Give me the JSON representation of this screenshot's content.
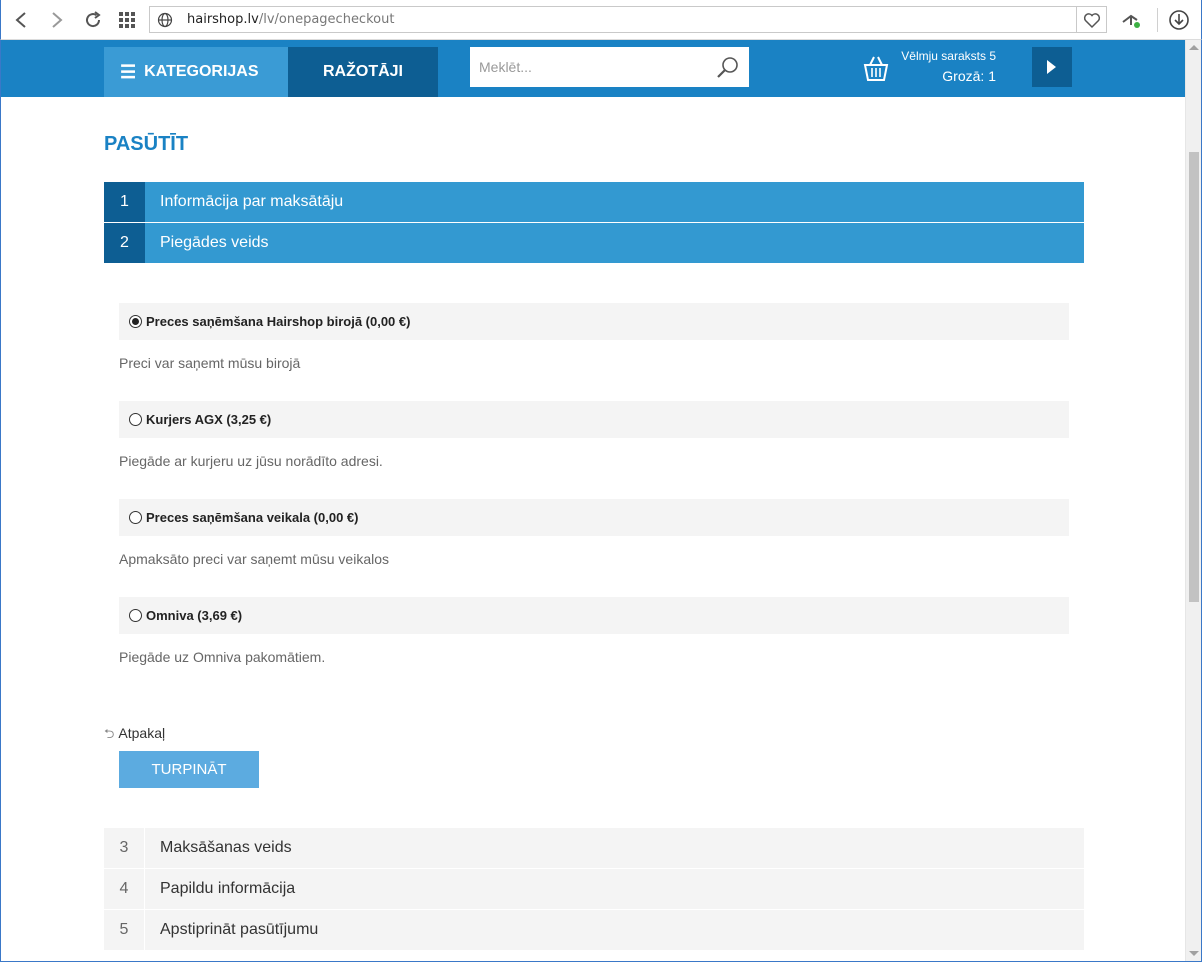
{
  "browser": {
    "url_host": "hairshop.lv",
    "url_path": "/lv/onepagecheckout"
  },
  "header": {
    "categories_label": "KATEGORIJAS",
    "brands_label": "RAŽOTĀJI",
    "search_placeholder": "Meklēt...",
    "wishlist_text": "Vēlmju saraksts 5",
    "cart_text": "Grozā: 1"
  },
  "page": {
    "title": "PASŪTĪT"
  },
  "steps_top": [
    {
      "num": "1",
      "label": "Informācija par maksātāju"
    },
    {
      "num": "2",
      "label": "Piegādes veids"
    }
  ],
  "shipping_options": [
    {
      "label": "Preces saņēmšana Hairshop birojā (0,00 €)",
      "desc": "Preci var saņemt mūsu birojā",
      "selected": true
    },
    {
      "label": "Kurjers AGX (3,25 €)",
      "desc": "Piegāde ar kurjeru uz jūsu norādīto adresi.",
      "selected": false
    },
    {
      "label": "Preces saņēmšana veikala (0,00 €)",
      "desc": "Apmaksāto preci var saņemt mūsu veikalos",
      "selected": false
    },
    {
      "label": "Omniva (3,69 €)",
      "desc": "Piegāde uz Omniva pakomātiem.",
      "selected": false
    }
  ],
  "actions": {
    "back_label": "Atpakaļ",
    "continue_label": "TURPINĀT"
  },
  "steps_bottom": [
    {
      "num": "3",
      "label": "Maksāšanas veids"
    },
    {
      "num": "4",
      "label": "Papildu informācija"
    },
    {
      "num": "5",
      "label": "Apstiprināt pasūtījumu"
    }
  ],
  "colors": {
    "brand_blue": "#1a82c4",
    "active_step": "#3399d1",
    "dark_blue": "#0d5e93",
    "button_blue": "#5cabe0"
  }
}
